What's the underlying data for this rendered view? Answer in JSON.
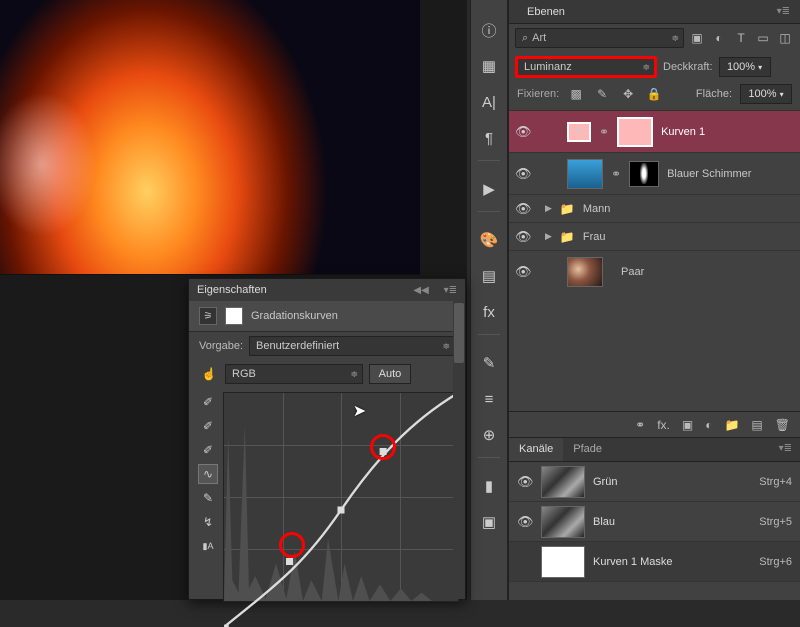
{
  "panels": {
    "layers_tab": "Ebenen",
    "properties_tab": "Eigenschaften",
    "channels_tab": "Kanäle",
    "paths_tab": "Pfade"
  },
  "layers": {
    "search_label": "Art",
    "blend_mode": "Luminanz",
    "opacity_label": "Deckkraft:",
    "opacity_value": "100%",
    "fill_label": "Fläche:",
    "fill_value": "100%",
    "lock_label": "Fixieren:",
    "items": [
      {
        "name": "Kurven 1"
      },
      {
        "name": "Blauer Schimmer"
      },
      {
        "name": "Mann"
      },
      {
        "name": "Frau"
      },
      {
        "name": "Paar"
      }
    ]
  },
  "properties": {
    "subtitle": "Gradationskurven",
    "preset_label": "Vorgabe:",
    "preset_value": "Benutzerdefiniert",
    "channel_value": "RGB",
    "auto_label": "Auto"
  },
  "channels": {
    "items": [
      {
        "name": "Grün",
        "shortcut": "Strg+4"
      },
      {
        "name": "Blau",
        "shortcut": "Strg+5"
      },
      {
        "name": "Kurven 1 Maske",
        "shortcut": "Strg+6"
      }
    ]
  },
  "footer": {
    "fx": "fx."
  }
}
